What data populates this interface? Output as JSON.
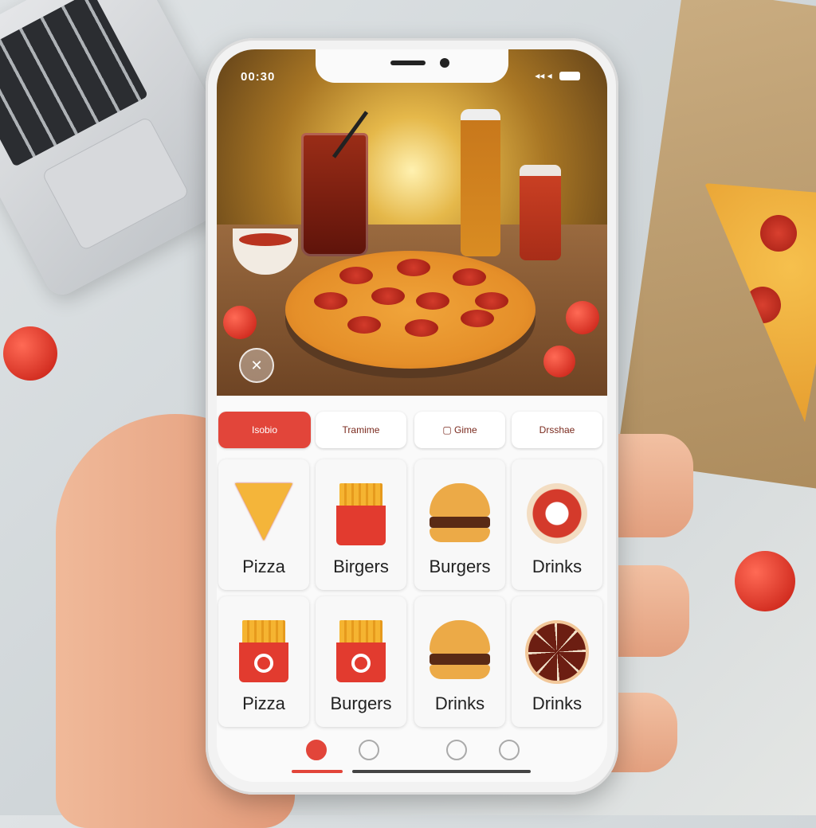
{
  "status_bar": {
    "time": "00:30",
    "icons": "◂◂ ◂"
  },
  "category_tabs": [
    {
      "label": "Isobio",
      "active": true
    },
    {
      "label": "Tramime",
      "active": false
    },
    {
      "label": "Gime",
      "active": false
    },
    {
      "label": "Drsshae",
      "active": false
    }
  ],
  "menu_grid": [
    {
      "label": "Pizza",
      "icon": "pizza-slice-icon"
    },
    {
      "label": "Birgers",
      "icon": "fries-icon"
    },
    {
      "label": "Burgers",
      "icon": "burger-icon"
    },
    {
      "label": "Drinks",
      "icon": "drink-icon"
    },
    {
      "label": "Pizza",
      "icon": "fries-icon"
    },
    {
      "label": "Burgers",
      "icon": "fries-icon"
    },
    {
      "label": "Drinks",
      "icon": "burger-icon"
    },
    {
      "label": "Drinks",
      "icon": "wheel-icon"
    }
  ],
  "bottom_nav": [
    {
      "icon": "home-icon",
      "active": true
    },
    {
      "icon": "search-icon",
      "active": false
    },
    {
      "icon": "orders-icon",
      "active": false
    },
    {
      "icon": "profile-icon",
      "active": false
    }
  ],
  "hero": {
    "close_symbol": "✕"
  },
  "colors": {
    "accent": "#e2453a",
    "card_bg": "#f8f8f8",
    "screen_bg": "#fafafa"
  }
}
